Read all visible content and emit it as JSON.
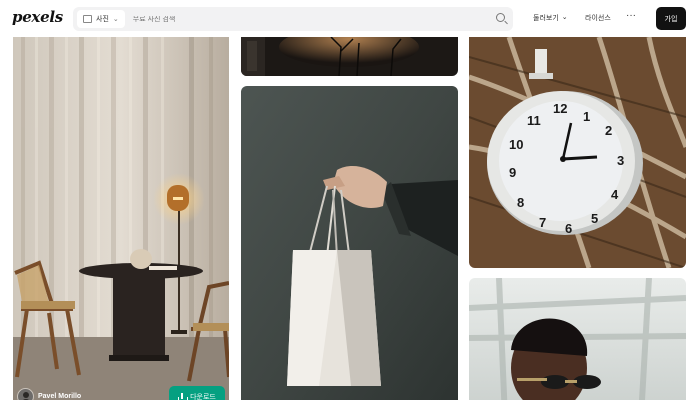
{
  "header": {
    "logo": "pexels",
    "search_type": "사진",
    "search_placeholder": "무료 사진 검색",
    "explore": "둘러보기",
    "license": "라이선스",
    "more": "···",
    "join": "가입"
  },
  "photos": [
    {
      "id": "interior",
      "author": "Pavel Morillo",
      "download_label": "다운로드"
    },
    {
      "id": "top-dark"
    },
    {
      "id": "shopping-bag"
    },
    {
      "id": "station-clock"
    },
    {
      "id": "portrait"
    }
  ],
  "colors": {
    "download_button": "#05a081",
    "join_button": "#111111"
  }
}
